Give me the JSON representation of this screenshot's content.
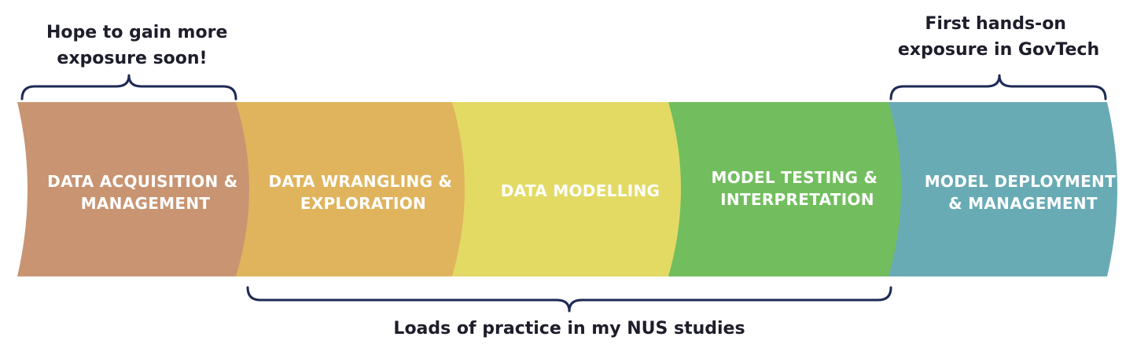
{
  "pipeline": {
    "segments": [
      {
        "lines": [
          "DATA ACQUISITION &",
          "MANAGEMENT"
        ],
        "color": "#c99472"
      },
      {
        "lines": [
          "DATA WRANGLING &",
          "EXPLORATION"
        ],
        "color": "#dfb45d"
      },
      {
        "lines": [
          "DATA MODELLING"
        ],
        "color": "#e3da64"
      },
      {
        "lines": [
          "MODEL  TESTING &",
          "INTERPRETATION"
        ],
        "color": "#72be5e"
      },
      {
        "lines": [
          "MODEL DEPLOYMENT",
          "& MANAGEMENT"
        ],
        "color": "#68abb5"
      }
    ]
  },
  "annotations": {
    "left_top": [
      "Hope to gain more",
      "exposure soon!"
    ],
    "right_top": [
      "First hands-on",
      "exposure in GovTech"
    ],
    "bottom": [
      "Loads of practice in my NUS studies"
    ]
  },
  "colors": {
    "brace": "#1e2a55",
    "text": "#1d1d2b",
    "label": "#ffffff"
  }
}
